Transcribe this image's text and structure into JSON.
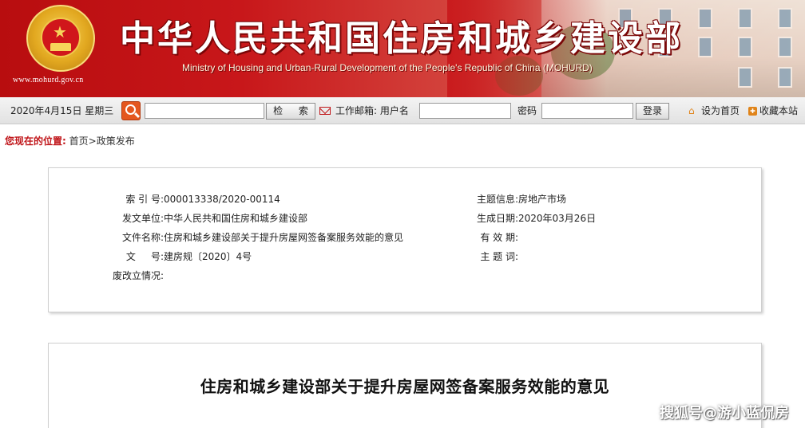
{
  "header": {
    "site_title": "中华人民共和国住房和城乡建设部",
    "site_subtitle": "Ministry of Housing and Urban-Rural Development of the People's Republic of China (MOHURD)",
    "site_url": "www.mohurd.gov.cn",
    "emblem_icon": "national-emblem-icon",
    "brand_color": "#c8171a"
  },
  "toolbar": {
    "date": "2020年4月15日 星期三",
    "search_icon": "search-icon",
    "search_value": "",
    "search_button": "检  索",
    "mail_icon": "mail-icon",
    "mail_label": "工作邮箱:  用户名",
    "username_value": "",
    "password_label": "密码",
    "password_value": "",
    "login_button": "登录",
    "set_home_icon": "home-icon",
    "set_home_label": "设为首页",
    "favorite_icon": "bookmark-icon",
    "favorite_label": "收藏本站"
  },
  "breadcrumb": {
    "prefix": "您现在的位置:",
    "home": "首页",
    "separator": ">",
    "current": "政策发布"
  },
  "info": {
    "left": [
      {
        "label": "索 引 号:",
        "value": "000013338/2020-00114"
      },
      {
        "label": "发文单位:",
        "value": "中华人民共和国住房和城乡建设部"
      },
      {
        "label": "文件名称:",
        "value": "住房和城乡建设部关于提升房屋网签备案服务效能的意见"
      },
      {
        "label": "文     号:",
        "value": "建房规〔2020〕4号"
      },
      {
        "label": "废改立情况:",
        "value": ""
      }
    ],
    "right": [
      {
        "label": "主题信息:",
        "value": "房地产市场"
      },
      {
        "label": "生成日期:",
        "value": "2020年03月26日"
      },
      {
        "label": "有 效 期:",
        "value": ""
      },
      {
        "label": "主 题 词:",
        "value": ""
      }
    ]
  },
  "article": {
    "title": "住房和城乡建设部关于提升房屋网签备案服务效能的意见"
  },
  "watermark": "搜狐号@游小蓝侃房"
}
